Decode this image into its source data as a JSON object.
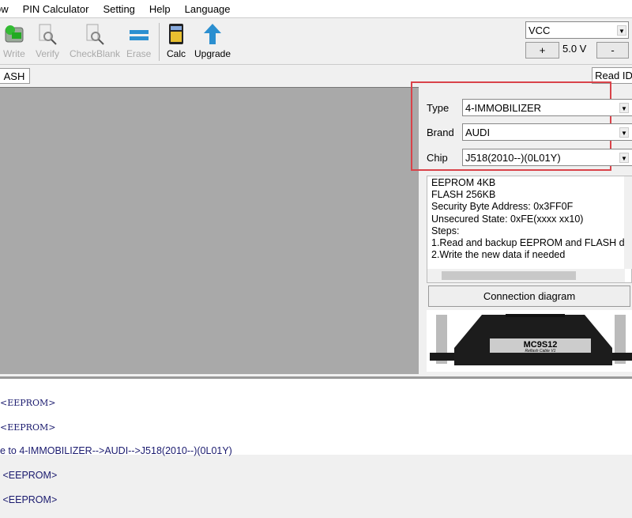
{
  "menu": [
    "ow",
    "PIN Calculator",
    "Setting",
    "Help",
    "Language"
  ],
  "toolbar": {
    "write": "Write",
    "verify": "Verify",
    "checkblank": "CheckBlank",
    "erase": "Erase",
    "calc": "Calc",
    "upgrade": "Upgrade"
  },
  "power": {
    "select": "VCC",
    "plus": "+",
    "voltage": "5.0 V",
    "minus": "-"
  },
  "tabs": {
    "flash": "ASH",
    "read_id": "Read ID"
  },
  "selector": {
    "type_label": "Type",
    "type_value": "4-IMMOBILIZER",
    "brand_label": "Brand",
    "brand_value": "AUDI",
    "chip_label": "Chip",
    "chip_value": "J518(2010--)(0L01Y)"
  },
  "info_lines": [
    "EEPROM 4KB",
    "FLASH 256KB",
    "Security Byte Address: 0x3FF0F",
    "Unsecured State: 0xFE(xxxx xx10)",
    "Steps:",
    "1.Read and backup EEPROM and FLASH d",
    "2.Write the new data if needed"
  ],
  "connection_button": "Connection diagram",
  "cable": {
    "title": "MC9S12",
    "subtitle": "Reflash Cable V1"
  },
  "log_lines": [
    "<EEPROM>",
    "<EEPROM>",
    "e to 4-IMMOBILIZER-->AUDI-->J518(2010--)(0L01Y)",
    " <EEPROM>",
    " <EEPROM>"
  ],
  "colors": {
    "highlight_box": "#d9434a",
    "log_text": "#1a1a6e"
  }
}
